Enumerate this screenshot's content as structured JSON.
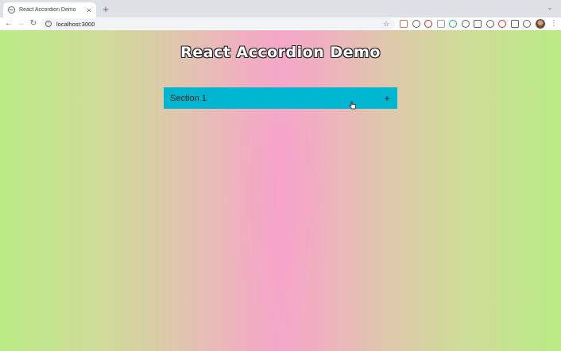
{
  "browser": {
    "tab": {
      "title": "React Accordion Demo",
      "close": "×"
    },
    "new_tab": "+",
    "window_menu": "⌄",
    "nav": {
      "back": "←",
      "forward": "→",
      "reload": "↻"
    },
    "address_bar": {
      "url": "localhost:3000"
    },
    "bookmark": "☆",
    "menu": "⋮",
    "extensions": [
      {
        "name": "extension-1",
        "color": "#e8694a"
      },
      {
        "name": "extension-2",
        "color": "#5f6368"
      },
      {
        "name": "extension-3",
        "color": "#c62828"
      },
      {
        "name": "extension-4",
        "color": "#9aa0a6"
      },
      {
        "name": "extension-5",
        "color": "#1fb46a"
      },
      {
        "name": "extension-6",
        "color": "#5f6368"
      },
      {
        "name": "extension-7",
        "color": "#5f6368"
      },
      {
        "name": "extension-8",
        "color": "#5f6368"
      },
      {
        "name": "extension-9",
        "color": "#d93025"
      },
      {
        "name": "extensions-puzzle",
        "color": "#5f6368"
      },
      {
        "name": "reading-list",
        "color": "#5f6368"
      }
    ]
  },
  "page": {
    "title": "React Accordion Demo",
    "accordion": [
      {
        "label": "Section 1",
        "toggle": "+"
      }
    ]
  },
  "colors": {
    "accordion_header": "#00b6d0",
    "gradient_edge": "#bbeb85",
    "gradient_center": "#f5a7c8"
  }
}
